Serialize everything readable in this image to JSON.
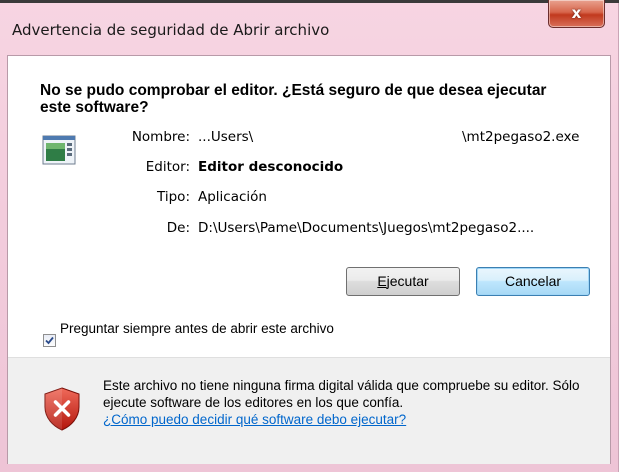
{
  "window": {
    "title": "Advertencia de seguridad de Abrir archivo",
    "close_glyph": "x"
  },
  "dialog": {
    "heading": "No se pudo comprobar el editor. ¿Está seguro de que desea ejecutar este software?",
    "app_icon": "application-window-icon",
    "fields": [
      {
        "label": "Nombre:",
        "value": "...Users\\",
        "value_suffix": "\\mt2pegaso2.exe"
      },
      {
        "label": "Editor:",
        "value": "Editor desconocido"
      },
      {
        "label": "Tipo:",
        "value": "Aplicación"
      },
      {
        "label": "De:",
        "value": "D:\\Users\\Pame\\Documents\\Juegos\\mt2pegaso2...."
      }
    ],
    "buttons": {
      "run_accel": "E",
      "run_rest": "jecutar",
      "cancel": "Cancelar"
    },
    "checkbox": {
      "checked": true,
      "label": "Preguntar siempre antes de abrir este archivo"
    }
  },
  "footer": {
    "icon": "shield-error-icon",
    "message": "Este archivo no tiene ninguna firma digital válida que compruebe su editor. Sólo ejecute software de los editores en los que confía.",
    "help_link": "¿Cómo puedo decidir qué software debo ejecutar?"
  },
  "colors": {
    "link": "#0066cc",
    "title_bar": "#f3cddd",
    "close_button": "#c1391e",
    "footer_bg": "#f0f0f0"
  }
}
